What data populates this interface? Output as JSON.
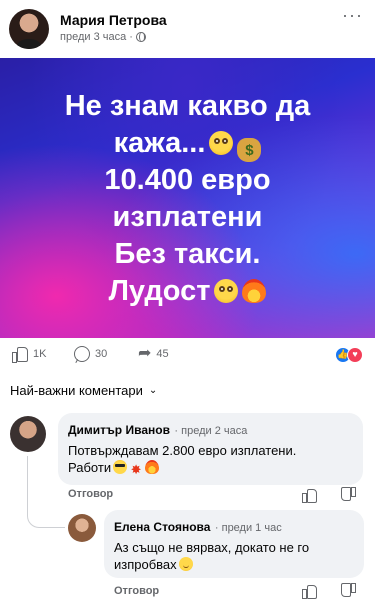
{
  "post": {
    "author": "Мария Петрова",
    "time": "преди 3 часа ·",
    "image_lines": [
      "Не знам какво да",
      "кажа...",
      "10.400 евро",
      "изплатени",
      "Без такси.",
      "Лудост"
    ],
    "reactions": {
      "likes": "1K",
      "comments": "30",
      "shares": "45"
    }
  },
  "sort": {
    "label": "Най-важни коментари"
  },
  "comments": [
    {
      "author": "Димитър Иванов",
      "time": "· преди 2 часа",
      "text_line1": "Потвърждавам 2.800 евро изплатени.",
      "text_line2": "Работи",
      "reply": "Отговор"
    },
    {
      "author": "Елена Стоянова",
      "time": "· преди 1 час",
      "text_line1": "Аз също не вярвах, докато не го",
      "text_line2": "изпробвах",
      "reply": "Отговор"
    }
  ],
  "icons": [
    "globe-icon",
    "more-icon",
    "flushed-emoji",
    "moneybag-emoji",
    "fire-emoji",
    "like-icon",
    "comment-icon",
    "share-icon",
    "like-reaction-icon",
    "love-reaction-icon",
    "chevron-down-icon",
    "sunglasses-emoji",
    "boom-emoji",
    "smile-emoji",
    "dislike-icon"
  ],
  "colors": {
    "accent": "#1877f2",
    "love": "#f33e58",
    "secondary_text": "#65676b",
    "bubble": "#f0f2f5"
  }
}
